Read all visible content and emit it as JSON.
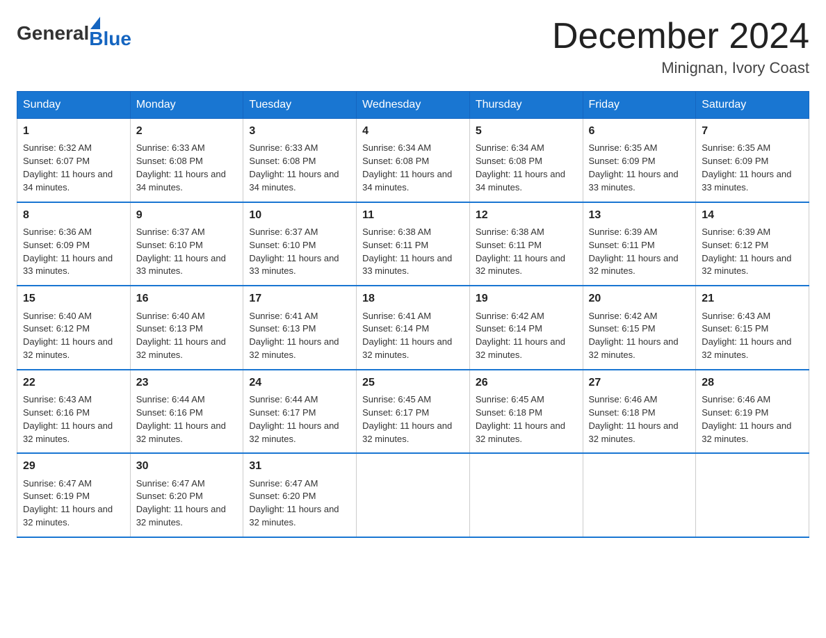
{
  "header": {
    "logo_general": "General",
    "logo_blue": "Blue",
    "month_title": "December 2024",
    "location": "Minignan, Ivory Coast"
  },
  "days_of_week": [
    "Sunday",
    "Monday",
    "Tuesday",
    "Wednesday",
    "Thursday",
    "Friday",
    "Saturday"
  ],
  "weeks": [
    [
      {
        "day": "1",
        "sunrise": "6:32 AM",
        "sunset": "6:07 PM",
        "daylight": "11 hours and 34 minutes."
      },
      {
        "day": "2",
        "sunrise": "6:33 AM",
        "sunset": "6:08 PM",
        "daylight": "11 hours and 34 minutes."
      },
      {
        "day": "3",
        "sunrise": "6:33 AM",
        "sunset": "6:08 PM",
        "daylight": "11 hours and 34 minutes."
      },
      {
        "day": "4",
        "sunrise": "6:34 AM",
        "sunset": "6:08 PM",
        "daylight": "11 hours and 34 minutes."
      },
      {
        "day": "5",
        "sunrise": "6:34 AM",
        "sunset": "6:08 PM",
        "daylight": "11 hours and 34 minutes."
      },
      {
        "day": "6",
        "sunrise": "6:35 AM",
        "sunset": "6:09 PM",
        "daylight": "11 hours and 33 minutes."
      },
      {
        "day": "7",
        "sunrise": "6:35 AM",
        "sunset": "6:09 PM",
        "daylight": "11 hours and 33 minutes."
      }
    ],
    [
      {
        "day": "8",
        "sunrise": "6:36 AM",
        "sunset": "6:09 PM",
        "daylight": "11 hours and 33 minutes."
      },
      {
        "day": "9",
        "sunrise": "6:37 AM",
        "sunset": "6:10 PM",
        "daylight": "11 hours and 33 minutes."
      },
      {
        "day": "10",
        "sunrise": "6:37 AM",
        "sunset": "6:10 PM",
        "daylight": "11 hours and 33 minutes."
      },
      {
        "day": "11",
        "sunrise": "6:38 AM",
        "sunset": "6:11 PM",
        "daylight": "11 hours and 33 minutes."
      },
      {
        "day": "12",
        "sunrise": "6:38 AM",
        "sunset": "6:11 PM",
        "daylight": "11 hours and 32 minutes."
      },
      {
        "day": "13",
        "sunrise": "6:39 AM",
        "sunset": "6:11 PM",
        "daylight": "11 hours and 32 minutes."
      },
      {
        "day": "14",
        "sunrise": "6:39 AM",
        "sunset": "6:12 PM",
        "daylight": "11 hours and 32 minutes."
      }
    ],
    [
      {
        "day": "15",
        "sunrise": "6:40 AM",
        "sunset": "6:12 PM",
        "daylight": "11 hours and 32 minutes."
      },
      {
        "day": "16",
        "sunrise": "6:40 AM",
        "sunset": "6:13 PM",
        "daylight": "11 hours and 32 minutes."
      },
      {
        "day": "17",
        "sunrise": "6:41 AM",
        "sunset": "6:13 PM",
        "daylight": "11 hours and 32 minutes."
      },
      {
        "day": "18",
        "sunrise": "6:41 AM",
        "sunset": "6:14 PM",
        "daylight": "11 hours and 32 minutes."
      },
      {
        "day": "19",
        "sunrise": "6:42 AM",
        "sunset": "6:14 PM",
        "daylight": "11 hours and 32 minutes."
      },
      {
        "day": "20",
        "sunrise": "6:42 AM",
        "sunset": "6:15 PM",
        "daylight": "11 hours and 32 minutes."
      },
      {
        "day": "21",
        "sunrise": "6:43 AM",
        "sunset": "6:15 PM",
        "daylight": "11 hours and 32 minutes."
      }
    ],
    [
      {
        "day": "22",
        "sunrise": "6:43 AM",
        "sunset": "6:16 PM",
        "daylight": "11 hours and 32 minutes."
      },
      {
        "day": "23",
        "sunrise": "6:44 AM",
        "sunset": "6:16 PM",
        "daylight": "11 hours and 32 minutes."
      },
      {
        "day": "24",
        "sunrise": "6:44 AM",
        "sunset": "6:17 PM",
        "daylight": "11 hours and 32 minutes."
      },
      {
        "day": "25",
        "sunrise": "6:45 AM",
        "sunset": "6:17 PM",
        "daylight": "11 hours and 32 minutes."
      },
      {
        "day": "26",
        "sunrise": "6:45 AM",
        "sunset": "6:18 PM",
        "daylight": "11 hours and 32 minutes."
      },
      {
        "day": "27",
        "sunrise": "6:46 AM",
        "sunset": "6:18 PM",
        "daylight": "11 hours and 32 minutes."
      },
      {
        "day": "28",
        "sunrise": "6:46 AM",
        "sunset": "6:19 PM",
        "daylight": "11 hours and 32 minutes."
      }
    ],
    [
      {
        "day": "29",
        "sunrise": "6:47 AM",
        "sunset": "6:19 PM",
        "daylight": "11 hours and 32 minutes."
      },
      {
        "day": "30",
        "sunrise": "6:47 AM",
        "sunset": "6:20 PM",
        "daylight": "11 hours and 32 minutes."
      },
      {
        "day": "31",
        "sunrise": "6:47 AM",
        "sunset": "6:20 PM",
        "daylight": "11 hours and 32 minutes."
      },
      null,
      null,
      null,
      null
    ]
  ]
}
